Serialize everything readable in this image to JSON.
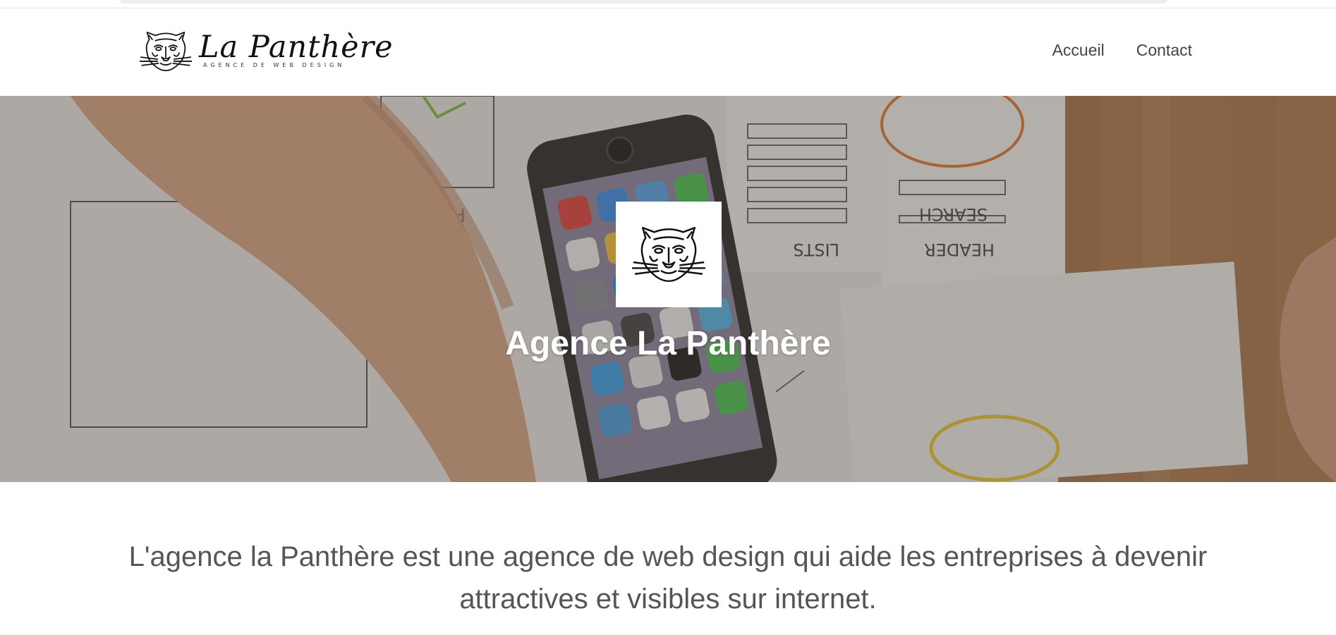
{
  "brand": {
    "name": "La Panthère",
    "tagline": "AGENCE DE WEB DESIGN"
  },
  "nav": {
    "items": [
      {
        "label": "Accueil"
      },
      {
        "label": "Contact"
      }
    ]
  },
  "hero": {
    "title": "Agence La Panthère"
  },
  "intro": {
    "text": "L'agence la Panthère est une agence de web design qui aide les entreprises à devenir attractives et visibles sur internet."
  },
  "colors": {
    "nav_text": "#444444",
    "intro_text": "#555555",
    "hero_title": "#ffffff"
  }
}
